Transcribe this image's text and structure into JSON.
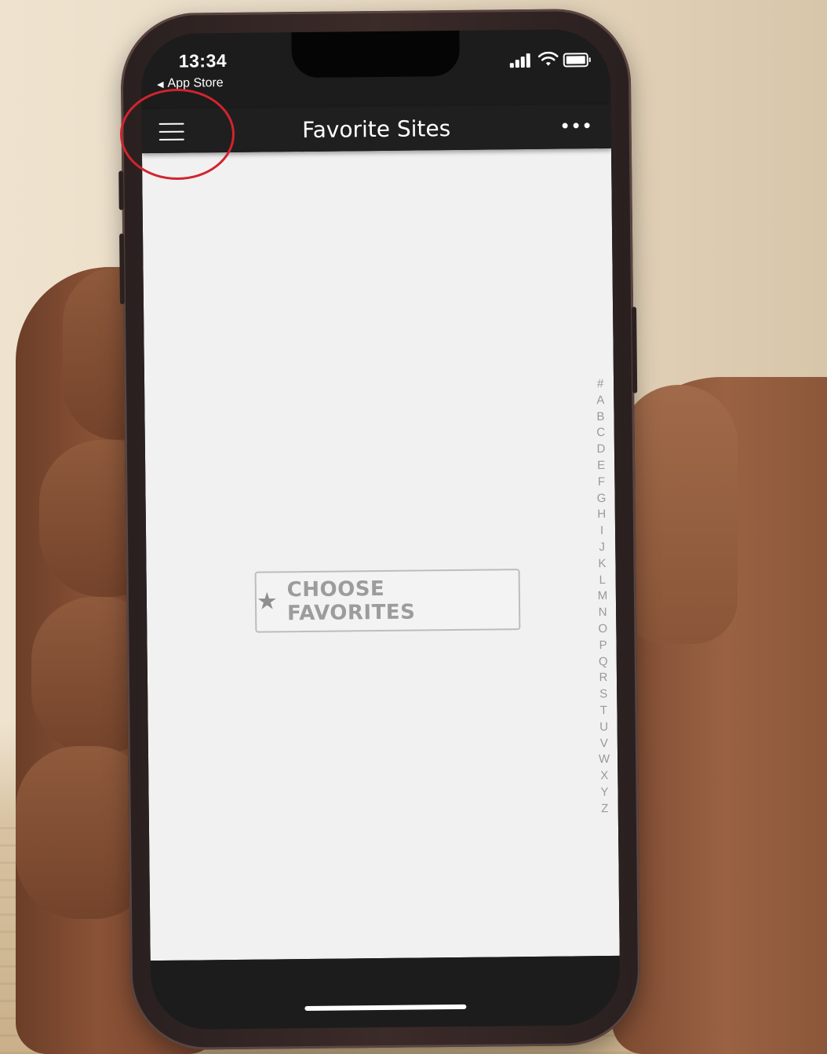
{
  "status_bar": {
    "time": "13:34",
    "back_app": "App Store",
    "back_arrow_icon": "back-triangle-icon",
    "icons": [
      "cellular-signal-icon",
      "wifi-icon",
      "battery-icon"
    ]
  },
  "header": {
    "title": "Favorite Sites",
    "menu_icon": "hamburger-menu-icon",
    "more_icon": "more-options-icon"
  },
  "main": {
    "choose_button_label": "CHOOSE FAVORITES",
    "choose_button_icon": "star-icon",
    "alpha_index": [
      "#",
      "A",
      "B",
      "C",
      "D",
      "E",
      "F",
      "G",
      "H",
      "I",
      "J",
      "K",
      "L",
      "M",
      "N",
      "O",
      "P",
      "Q",
      "R",
      "S",
      "T",
      "U",
      "V",
      "W",
      "X",
      "Y",
      "Z"
    ]
  },
  "annotation": {
    "highlight_color": "#d1242f",
    "highlight_target": "hamburger-menu-icon"
  },
  "colors": {
    "header_bg": "#1f1f1f",
    "content_bg": "#f1f1f1",
    "button_text": "#9c9c9c"
  }
}
